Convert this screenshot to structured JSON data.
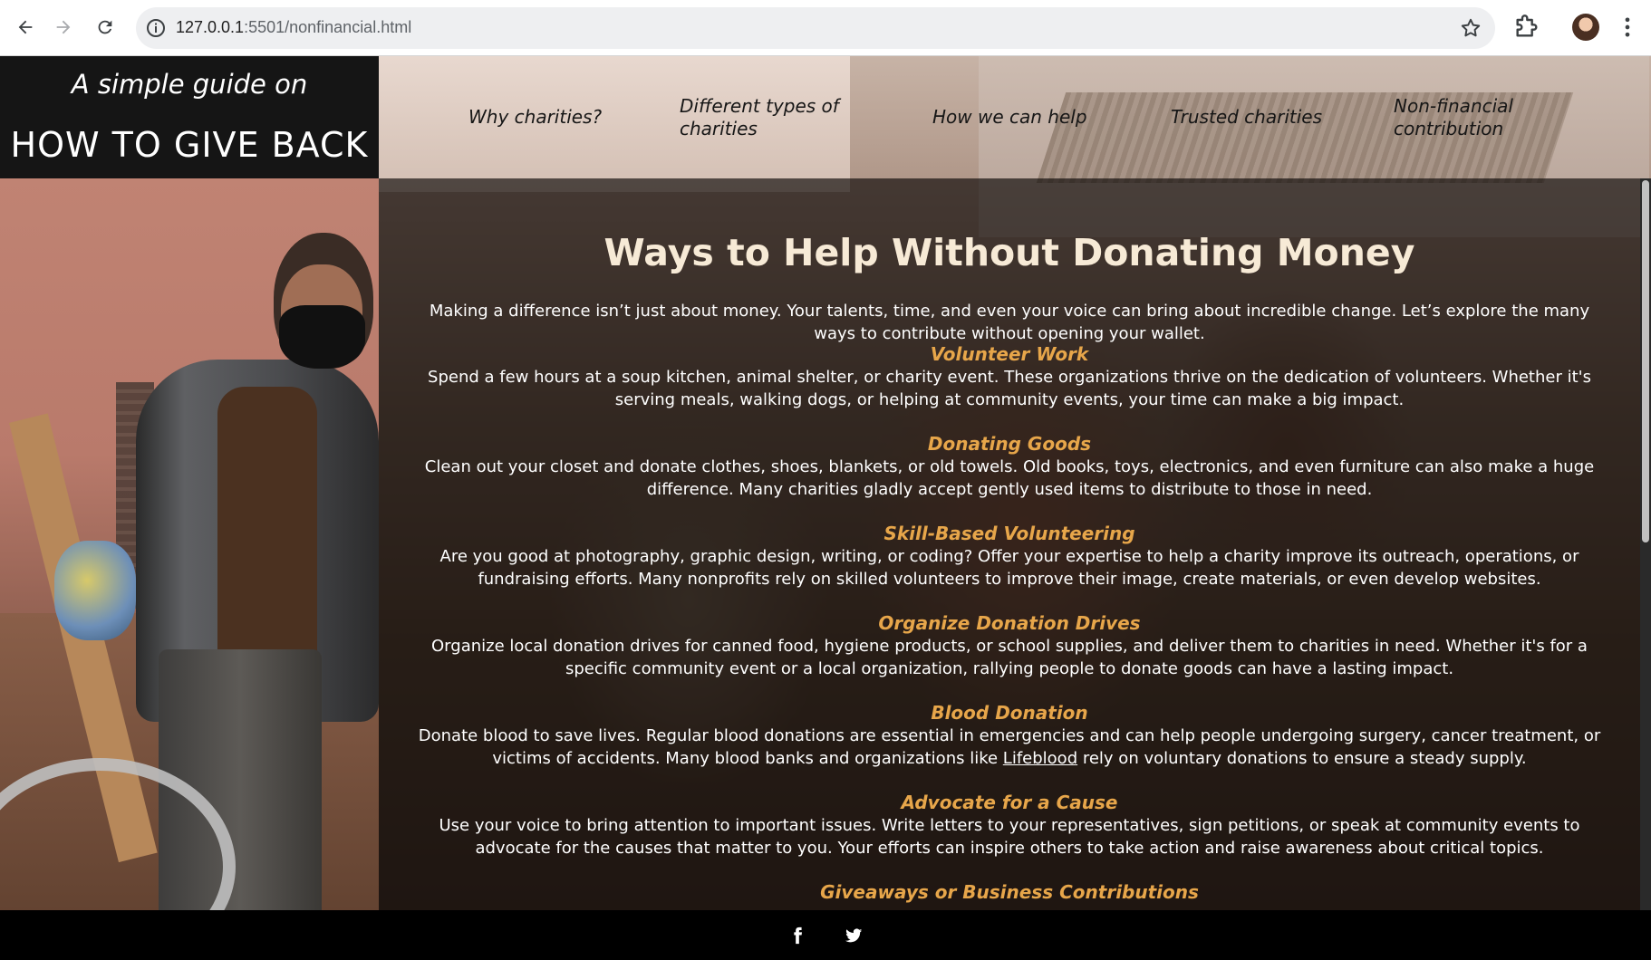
{
  "browser": {
    "url_host": "127.0.0.1",
    "url_rest": ":5501/nonfinancial.html"
  },
  "brand": {
    "tagline": "A simple guide on",
    "title": "HOW TO GIVE BACK"
  },
  "nav": {
    "items": [
      {
        "label": "Why charities?"
      },
      {
        "label": "Different types of charities"
      },
      {
        "label": "How we can help"
      },
      {
        "label": "Trusted charities"
      },
      {
        "label": "Non-financial contribution"
      }
    ]
  },
  "main": {
    "heading": "Ways to Help Without Donating Money",
    "intro": "Making a difference isn’t just about money. Your talents, time, and even your voice can bring about incredible change. Let’s explore the many ways to contribute without opening your wallet.",
    "sections": [
      {
        "title": "Volunteer Work",
        "text": "Spend a few hours at a soup kitchen, animal shelter, or charity event. These organizations thrive on the dedication of volunteers. Whether it's serving meals, walking dogs, or helping at community events, your time can make a big impact."
      },
      {
        "title": "Donating Goods",
        "text": "Clean out your closet and donate clothes, shoes, blankets, or old towels. Old books, toys, electronics, and even furniture can also make a huge difference. Many charities gladly accept gently used items to distribute to those in need."
      },
      {
        "title": "Skill-Based Volunteering",
        "text": "Are you good at photography, graphic design, writing, or coding? Offer your expertise to help a charity improve its outreach, operations, or fundraising efforts. Many nonprofits rely on skilled volunteers to improve their image, create materials, or even develop websites."
      },
      {
        "title": "Organize Donation Drives",
        "text": "Organize local donation drives for canned food, hygiene products, or school supplies, and deliver them to charities in need. Whether it's for a specific community event or a local organization, rallying people to donate goods can have a lasting impact."
      },
      {
        "title": "Blood Donation",
        "text_before": "Donate blood to save lives. Regular blood donations are essential in emergencies and can help people undergoing surgery, cancer treatment, or victims of accidents. Many blood banks and organizations like ",
        "link": "Lifeblood",
        "text_after": " rely on voluntary donations to ensure a steady supply."
      },
      {
        "title": "Advocate for a Cause",
        "text": "Use your voice to bring attention to important issues. Write letters to your representatives, sign petitions, or speak at community events to advocate for the causes that matter to you. Your efforts can inspire others to take action and raise awareness about critical topics."
      },
      {
        "title": "Giveaways or Business Contributions"
      }
    ]
  },
  "footer": {
    "icons": [
      "facebook-icon",
      "twitter-icon"
    ]
  },
  "colors": {
    "accent": "#e7a64a",
    "heading": "#f7ead6",
    "brand_bg": "#151515",
    "footer_bg": "#000000"
  }
}
